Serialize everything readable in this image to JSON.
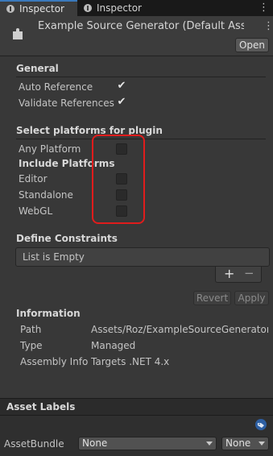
{
  "tabs": [
    {
      "label": "Inspector",
      "active": true
    },
    {
      "label": "Inspector",
      "active": false
    }
  ],
  "header": {
    "title": "Example Source Generator (Default Asse",
    "open_label": "Open"
  },
  "general": {
    "title": "General",
    "auto_reference": {
      "label": "Auto Reference",
      "checked": true
    },
    "validate_references": {
      "label": "Validate References",
      "checked": true
    }
  },
  "platforms": {
    "title": "Select platforms for plugin",
    "any_platform": {
      "label": "Any Platform",
      "checked": false
    },
    "include_label": "Include Platforms",
    "items": [
      {
        "label": "Editor",
        "checked": false
      },
      {
        "label": "Standalone",
        "checked": false
      },
      {
        "label": "WebGL",
        "checked": false
      }
    ]
  },
  "constraints": {
    "title": "Define Constraints",
    "empty_text": "List is Empty",
    "add": "+",
    "remove": "−"
  },
  "actions": {
    "revert": "Revert",
    "apply": "Apply"
  },
  "information": {
    "title": "Information",
    "rows": [
      {
        "key": "Path",
        "value": "Assets/Roz/ExampleSourceGenerator.dll"
      },
      {
        "key": "Type",
        "value": "Managed"
      },
      {
        "key": "Assembly Info",
        "value": "Targets .NET 4.x"
      }
    ]
  },
  "asset_labels": {
    "title": "Asset Labels",
    "bundle_label": "AssetBundle",
    "bundle_value": "None",
    "variant_value": "None"
  },
  "colors": {
    "accent": "#3a79bb",
    "highlight": "#e01c1c",
    "panel": "#383838"
  }
}
